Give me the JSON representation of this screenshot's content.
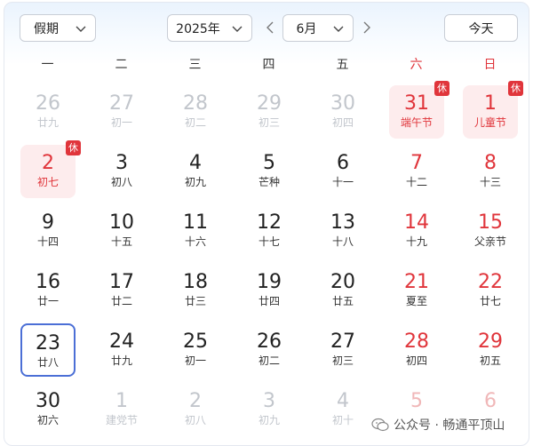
{
  "toolbar": {
    "holiday_select": "假期",
    "year_select": "2025年",
    "month_select": "6月",
    "today_button": "今天"
  },
  "weekdays": [
    "一",
    "二",
    "三",
    "四",
    "五",
    "六",
    "日"
  ],
  "rest_badge": "休",
  "weeks": [
    [
      {
        "day": "26",
        "lunar": "廿九",
        "state": "other"
      },
      {
        "day": "27",
        "lunar": "初一",
        "state": "other"
      },
      {
        "day": "28",
        "lunar": "初二",
        "state": "other"
      },
      {
        "day": "29",
        "lunar": "初三",
        "state": "other"
      },
      {
        "day": "30",
        "lunar": "初四",
        "state": "other"
      },
      {
        "day": "31",
        "lunar": "端午节",
        "state": "rest"
      },
      {
        "day": "1",
        "lunar": "儿童节",
        "state": "rest"
      }
    ],
    [
      {
        "day": "2",
        "lunar": "初七",
        "state": "rest"
      },
      {
        "day": "3",
        "lunar": "初八",
        "state": "normal"
      },
      {
        "day": "4",
        "lunar": "初九",
        "state": "normal"
      },
      {
        "day": "5",
        "lunar": "芒种",
        "state": "normal"
      },
      {
        "day": "6",
        "lunar": "十一",
        "state": "normal"
      },
      {
        "day": "7",
        "lunar": "十二",
        "state": "normal"
      },
      {
        "day": "8",
        "lunar": "十三",
        "state": "normal"
      }
    ],
    [
      {
        "day": "9",
        "lunar": "十四",
        "state": "normal"
      },
      {
        "day": "10",
        "lunar": "十五",
        "state": "normal"
      },
      {
        "day": "11",
        "lunar": "十六",
        "state": "normal"
      },
      {
        "day": "12",
        "lunar": "十七",
        "state": "normal"
      },
      {
        "day": "13",
        "lunar": "十八",
        "state": "normal"
      },
      {
        "day": "14",
        "lunar": "十九",
        "state": "normal"
      },
      {
        "day": "15",
        "lunar": "父亲节",
        "state": "normal"
      }
    ],
    [
      {
        "day": "16",
        "lunar": "廿一",
        "state": "normal"
      },
      {
        "day": "17",
        "lunar": "廿二",
        "state": "normal"
      },
      {
        "day": "18",
        "lunar": "廿三",
        "state": "normal"
      },
      {
        "day": "19",
        "lunar": "廿四",
        "state": "normal"
      },
      {
        "day": "20",
        "lunar": "廿五",
        "state": "normal"
      },
      {
        "day": "21",
        "lunar": "夏至",
        "state": "normal"
      },
      {
        "day": "22",
        "lunar": "廿七",
        "state": "normal"
      }
    ],
    [
      {
        "day": "23",
        "lunar": "廿八",
        "state": "today"
      },
      {
        "day": "24",
        "lunar": "廿九",
        "state": "normal"
      },
      {
        "day": "25",
        "lunar": "初一",
        "state": "normal"
      },
      {
        "day": "26",
        "lunar": "初二",
        "state": "normal"
      },
      {
        "day": "27",
        "lunar": "初三",
        "state": "normal"
      },
      {
        "day": "28",
        "lunar": "初四",
        "state": "normal"
      },
      {
        "day": "29",
        "lunar": "初五",
        "state": "normal"
      }
    ],
    [
      {
        "day": "30",
        "lunar": "初六",
        "state": "normal"
      },
      {
        "day": "1",
        "lunar": "建党节",
        "state": "other"
      },
      {
        "day": "2",
        "lunar": "初八",
        "state": "other"
      },
      {
        "day": "3",
        "lunar": "初九",
        "state": "other"
      },
      {
        "day": "4",
        "lunar": "初十",
        "state": "other"
      },
      {
        "day": "5",
        "lunar": "",
        "state": "other"
      },
      {
        "day": "6",
        "lunar": "",
        "state": "other"
      }
    ]
  ],
  "watermark": "公众号 · 畅通平顶山",
  "colors": {
    "weekend_red": "#e0353b",
    "rest_bg": "#fdeced",
    "today_border": "#4b6fd6",
    "muted": "#c2c6cc"
  }
}
